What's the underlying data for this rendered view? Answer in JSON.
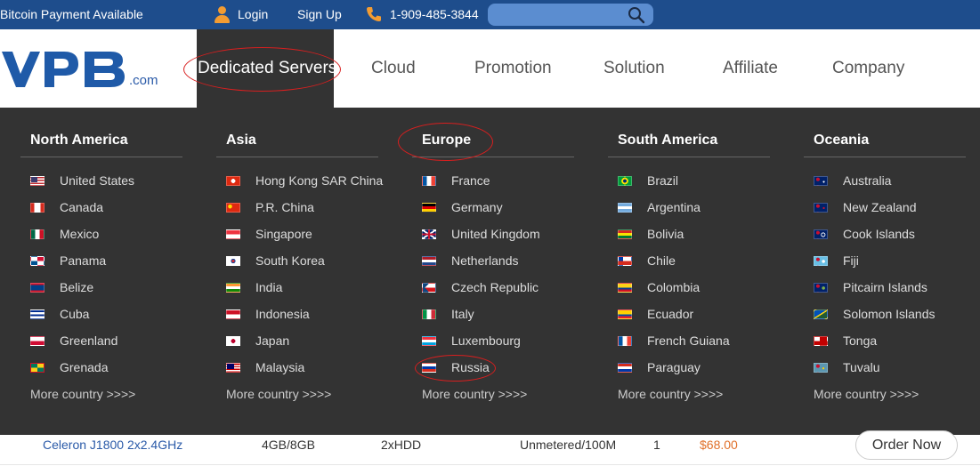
{
  "topbar": {
    "bitcoin": "Bitcoin Payment Available",
    "login": "Login",
    "signup": "Sign Up",
    "phone": "1-909-485-3844",
    "search_value": ""
  },
  "logo": {
    "suffix": ".com"
  },
  "nav": {
    "items": [
      "Dedicated Servers",
      "Cloud",
      "Promotion",
      "Solution",
      "Affiliate",
      "Company"
    ]
  },
  "menu": {
    "columns": [
      {
        "title": "North America",
        "countries": [
          "United States",
          "Canada",
          "Mexico",
          "Panama",
          "Belize",
          "Cuba",
          "Greenland",
          "Grenada"
        ],
        "more": "More country >>>>"
      },
      {
        "title": "Asia",
        "countries": [
          "Hong Kong SAR China",
          "P.R. China",
          "Singapore",
          "South Korea",
          "India",
          "Indonesia",
          "Japan",
          "Malaysia"
        ],
        "more": "More country >>>>"
      },
      {
        "title": "Europe",
        "countries": [
          "France",
          "Germany",
          "United Kingdom",
          "Netherlands",
          "Czech Republic",
          "Italy",
          "Luxembourg",
          "Russia"
        ],
        "more": "More country >>>>"
      },
      {
        "title": "South America",
        "countries": [
          "Brazil",
          "Argentina",
          "Bolivia",
          "Chile",
          "Colombia",
          "Ecuador",
          "French Guiana",
          "Paraguay"
        ],
        "more": "More country >>>>"
      },
      {
        "title": "Oceania",
        "countries": [
          "Australia",
          "New Zealand",
          "Cook Islands",
          "Fiji",
          "Pitcairn Islands",
          "Solomon Islands",
          "Tonga",
          "Tuvalu"
        ],
        "more": "More country >>>>"
      }
    ]
  },
  "server_row": {
    "cpu": "Celeron J1800 2x2.4GHz",
    "ram": "4GB/8GB",
    "disk": "2xHDD",
    "bandwidth": "Unmetered/100M",
    "ip": "1",
    "price": "$68.00",
    "order": "Order Now"
  },
  "colors": {
    "topbar": "#1e4d8c",
    "menu_bg": "#333333",
    "brand": "#2a5aa8",
    "accent": "#f39c32",
    "annotation": "#d81f1f",
    "price": "#e0702a"
  }
}
